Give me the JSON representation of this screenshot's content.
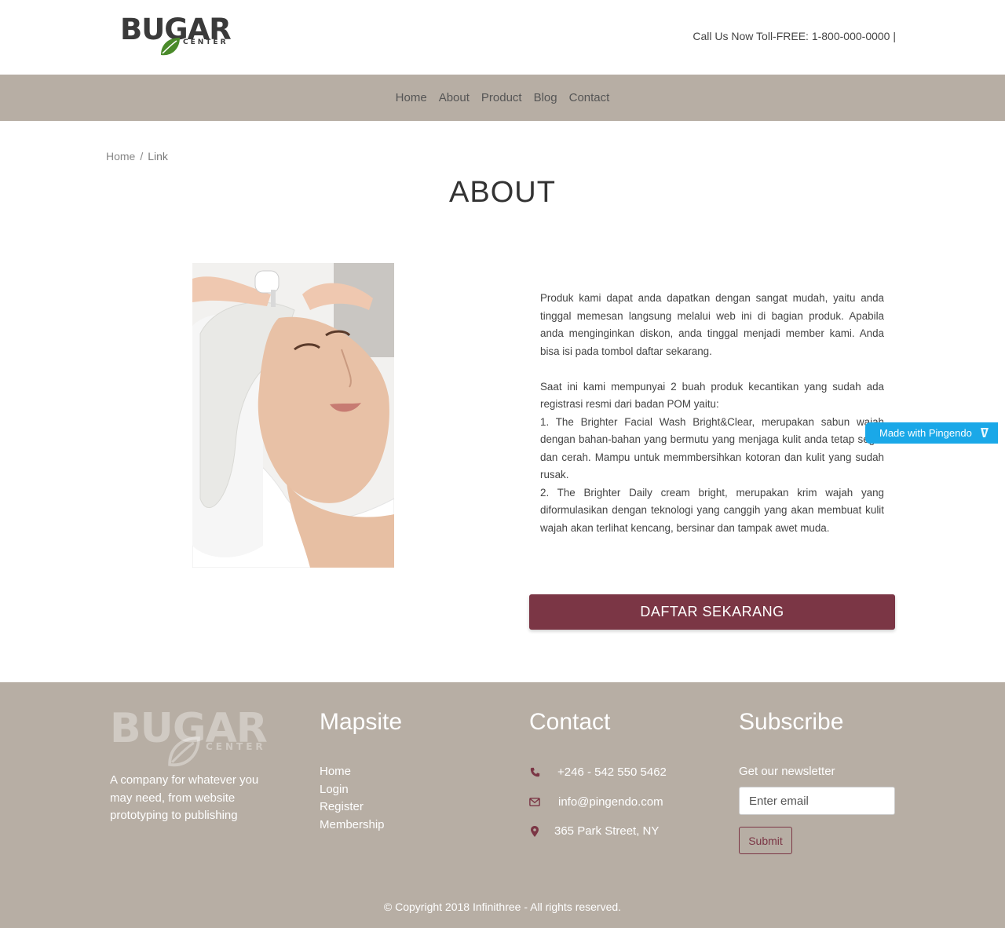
{
  "brand": {
    "name": "BUGAR",
    "sub": "CENTER"
  },
  "header": {
    "callus": "Call Us Now Toll-FREE: 1-800-000-0000 |"
  },
  "nav": {
    "items": [
      "Home",
      "About",
      "Product",
      "Blog",
      "Contact"
    ]
  },
  "breadcrumb": {
    "home": "Home",
    "sep": "/",
    "current": "Link"
  },
  "page": {
    "title": "ABOUT"
  },
  "about": {
    "p1": "Produk kami dapat anda dapatkan dengan sangat mudah, yaitu anda tinggal memesan langsung melalui web ini di bagian produk. Apabila anda menginginkan diskon, anda tinggal menjadi member kami. Anda bisa isi pada tombol daftar sekarang.",
    "p2": "Saat ini kami mempunyai 2 buah produk kecantikan yang sudah ada registrasi resmi dari badan POM yaitu:",
    "p3": "1. The Brighter Facial Wash Bright&Clear, merupakan sabun wajah dengan bahan-bahan yang bermutu yang menjaga kulit anda tetap segar dan cerah. Mampu untuk memmbersihkan kotoran dan kulit yang sudah rusak.",
    "p4": "2. The Brighter Daily cream bright, merupakan krim wajah yang diformulasikan dengan teknologi yang canggih yang akan membuat kulit wajah akan terlihat kencang, bersinar dan tampak awet muda.",
    "button": "DAFTAR SEKARANG"
  },
  "badge": {
    "label": "Made with Pingendo"
  },
  "footer": {
    "description": "A company for whatever you may need, from website prototyping to publishing",
    "mapsite": {
      "title": "Mapsite",
      "links": [
        "Home",
        "Login",
        "Register",
        "Membership"
      ]
    },
    "contact": {
      "title": "Contact",
      "phone": "+246 - 542 550 5462",
      "email": "info@pingendo.com",
      "address": "365 Park Street, NY"
    },
    "subscribe": {
      "title": "Subscribe",
      "label": "Get our newsletter",
      "placeholder": "Enter email",
      "button": "Submit"
    },
    "copyright": "© Copyright 2018 Infinithree - All rights reserved."
  },
  "colors": {
    "accent": "#7b3645",
    "band": "#b7aea4",
    "badge": "#1aa8e8"
  }
}
